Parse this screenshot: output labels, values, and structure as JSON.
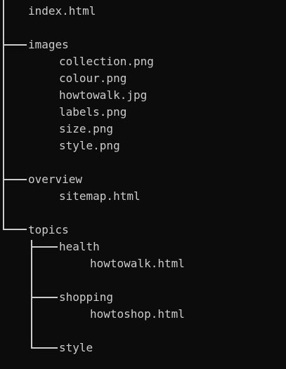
{
  "tree": {
    "root_file": "index.html",
    "folders": [
      {
        "name": "images",
        "files": [
          "collection.png",
          "colour.png",
          "howtowalk.jpg",
          "labels.png",
          "size.png",
          "style.png"
        ]
      },
      {
        "name": "overview",
        "files": [
          "sitemap.html"
        ]
      },
      {
        "name": "topics",
        "subfolders": [
          {
            "name": "health",
            "files": [
              "howtowalk.html"
            ]
          },
          {
            "name": "shopping",
            "files": [
              "howtoshop.html"
            ]
          },
          {
            "name": "style",
            "files": []
          }
        ]
      }
    ]
  }
}
